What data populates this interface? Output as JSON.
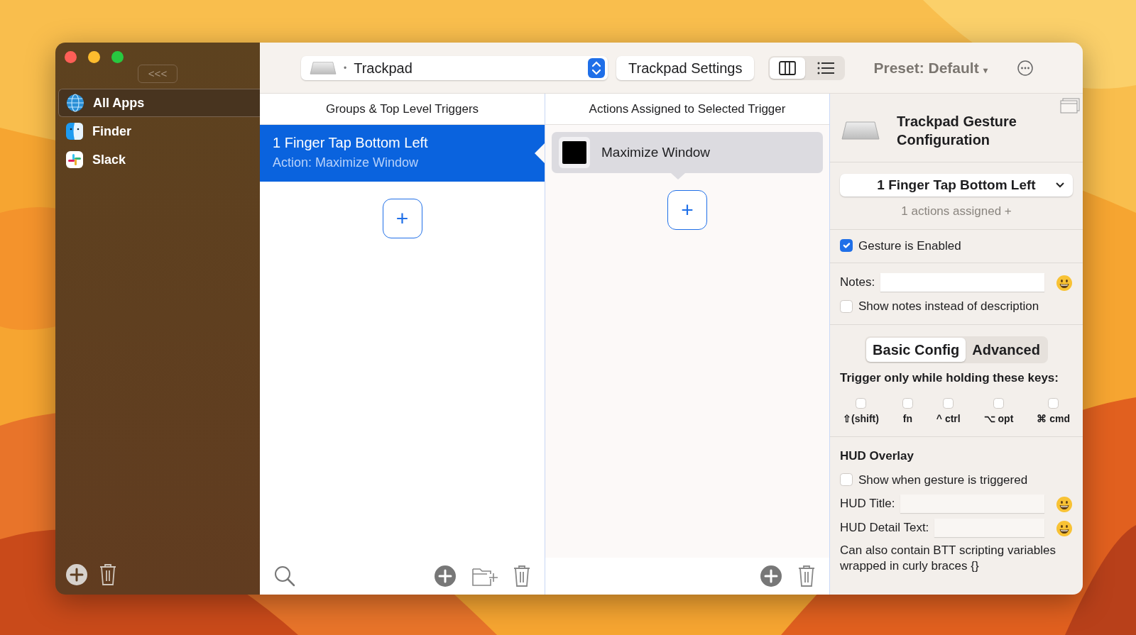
{
  "window": {
    "collapse_button": "<<<"
  },
  "sidebar": {
    "items": [
      {
        "label": "All Apps",
        "selected": true,
        "kind": "globe"
      },
      {
        "label": "Finder",
        "selected": false,
        "kind": "finder"
      },
      {
        "label": "Slack",
        "selected": false,
        "kind": "slack"
      }
    ]
  },
  "toolbar": {
    "device_bullet": "•",
    "device": "Trackpad",
    "settings_button": "Trackpad Settings",
    "views": [
      {
        "kind": "columns",
        "selected": true
      },
      {
        "kind": "list",
        "selected": false
      }
    ],
    "preset": "Preset: Default",
    "preset_caret": "▾"
  },
  "triggers": {
    "heading": "Groups & Top Level Triggers",
    "items": [
      {
        "title": "1 Finger Tap Bottom Left",
        "subtitle": "Action: Maximize Window",
        "selected": true
      }
    ],
    "add_button": "+"
  },
  "actions": {
    "heading": "Actions Assigned to Selected Trigger",
    "items": [
      {
        "label": "Maximize Window",
        "selected": true
      }
    ],
    "add_button": "+"
  },
  "config": {
    "title": "Trackpad Gesture Configuration",
    "trigger_select": "1 Finger Tap Bottom Left",
    "actions_assigned": "1 actions assigned +",
    "enabled": {
      "label": "Gesture is Enabled",
      "checked": true
    },
    "notes_label": "Notes:",
    "show_notes": {
      "label": "Show notes instead of description",
      "checked": false
    },
    "tabs": [
      {
        "label": "Basic Config",
        "selected": true
      },
      {
        "label": "Advanced",
        "selected": false
      }
    ],
    "keys_heading": "Trigger only while holding these keys:",
    "keys": [
      {
        "label": "⇧(shift)",
        "checked": false
      },
      {
        "label": "fn",
        "checked": false
      },
      {
        "label": "^ ctrl",
        "checked": false
      },
      {
        "label": "⌥ opt",
        "checked": false
      },
      {
        "label": "⌘ cmd",
        "checked": false
      }
    ],
    "hud_heading": "HUD Overlay",
    "hud_show": {
      "label": "Show when gesture is triggered",
      "checked": false
    },
    "hud_title_label": "HUD Title:",
    "hud_detail_label": "HUD Detail Text:",
    "hint": "Can also contain BTT scripting variables wrapped in curly braces {}"
  }
}
